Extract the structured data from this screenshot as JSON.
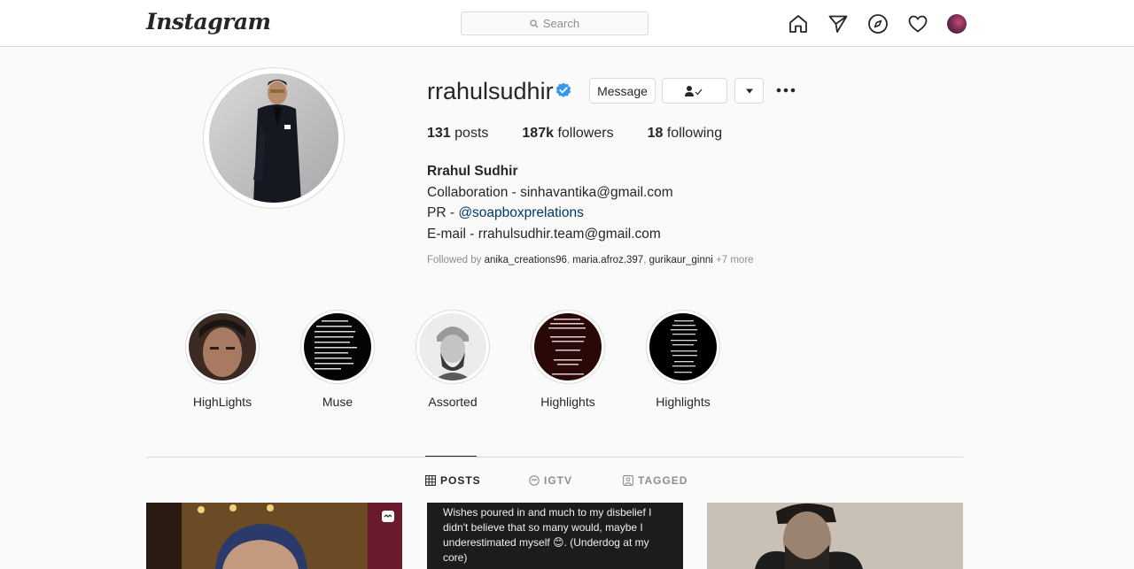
{
  "nav": {
    "logo": "Instagram",
    "search_placeholder": "Search",
    "icons": [
      "home-icon",
      "direct-icon",
      "explore-icon",
      "activity-icon",
      "profile-avatar"
    ]
  },
  "profile": {
    "username": "rrahulsudhir",
    "verified": true,
    "message_label": "Message",
    "stats": {
      "posts_count": "131",
      "posts_label": "posts",
      "followers_count": "187k",
      "followers_label": "followers",
      "following_count": "18",
      "following_label": "following"
    },
    "full_name": "Rrahul Sudhir",
    "bio_line1": "Collaboration - sinhavantika@gmail.com",
    "bio_pr_prefix": "PR - ",
    "bio_pr_link": "@soapboxprelations",
    "bio_line3": "E-mail - rrahulsudhir.team@gmail.com",
    "followed_by_prefix": "Followed by ",
    "followed_by_users": [
      "anika_creations96",
      "maria.afroz.397",
      "gurikaur_ginni"
    ],
    "followed_by_more": "+7 more"
  },
  "highlights": [
    {
      "label": "HighLights"
    },
    {
      "label": "Muse"
    },
    {
      "label": "Assorted"
    },
    {
      "label": "Highlights"
    },
    {
      "label": "Highlights"
    }
  ],
  "tabs": [
    {
      "label": "POSTS",
      "active": true
    },
    {
      "label": "IGTV",
      "active": false
    },
    {
      "label": "TAGGED",
      "active": false
    }
  ],
  "posts": {
    "post2_text": "Wishes poured in and much to my disbelief I didn't believe that so many would, maybe I underestimated myself 😊. (Underdog at my core)"
  },
  "colors": {
    "verified_blue": "#3897f0",
    "link": "#00376b",
    "border": "#dbdbdb",
    "muted": "#8e8e8e"
  }
}
